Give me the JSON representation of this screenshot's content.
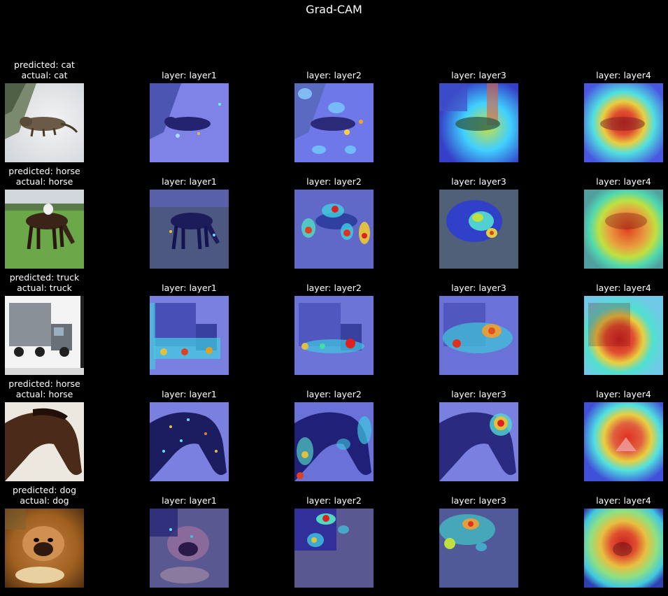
{
  "figure": {
    "title": "Grad-CAM"
  },
  "rows": [
    {
      "name": "cat",
      "prediction_label": "predicted: cat",
      "actual_label": "actual: cat",
      "layers": [
        "layer: layer1",
        "layer: layer2",
        "layer: layer3",
        "layer: layer4"
      ]
    },
    {
      "name": "horse",
      "prediction_label": "predicted: horse",
      "actual_label": "actual: horse",
      "layers": [
        "layer: layer1",
        "layer: layer2",
        "layer: layer3",
        "layer: layer4"
      ]
    },
    {
      "name": "truck",
      "prediction_label": "predicted: truck",
      "actual_label": "actual: truck",
      "layers": [
        "layer: layer1",
        "layer: layer2",
        "layer: layer3",
        "layer: layer4"
      ]
    },
    {
      "name": "horse",
      "prediction_label": "predicted: horse",
      "actual_label": "actual: horse",
      "layers": [
        "layer: layer1",
        "layer: layer2",
        "layer: layer3",
        "layer: layer4"
      ]
    },
    {
      "name": "dog",
      "prediction_label": "predicted: dog",
      "actual_label": "actual: dog",
      "layers": [
        "layer: layer1",
        "layer: layer2",
        "layer: layer3",
        "layer: layer4"
      ]
    }
  ],
  "colors": {
    "background": "#000000",
    "text": "#ffffff",
    "overlay_low": "#2a2ad0",
    "overlay_high": "#e02020"
  }
}
